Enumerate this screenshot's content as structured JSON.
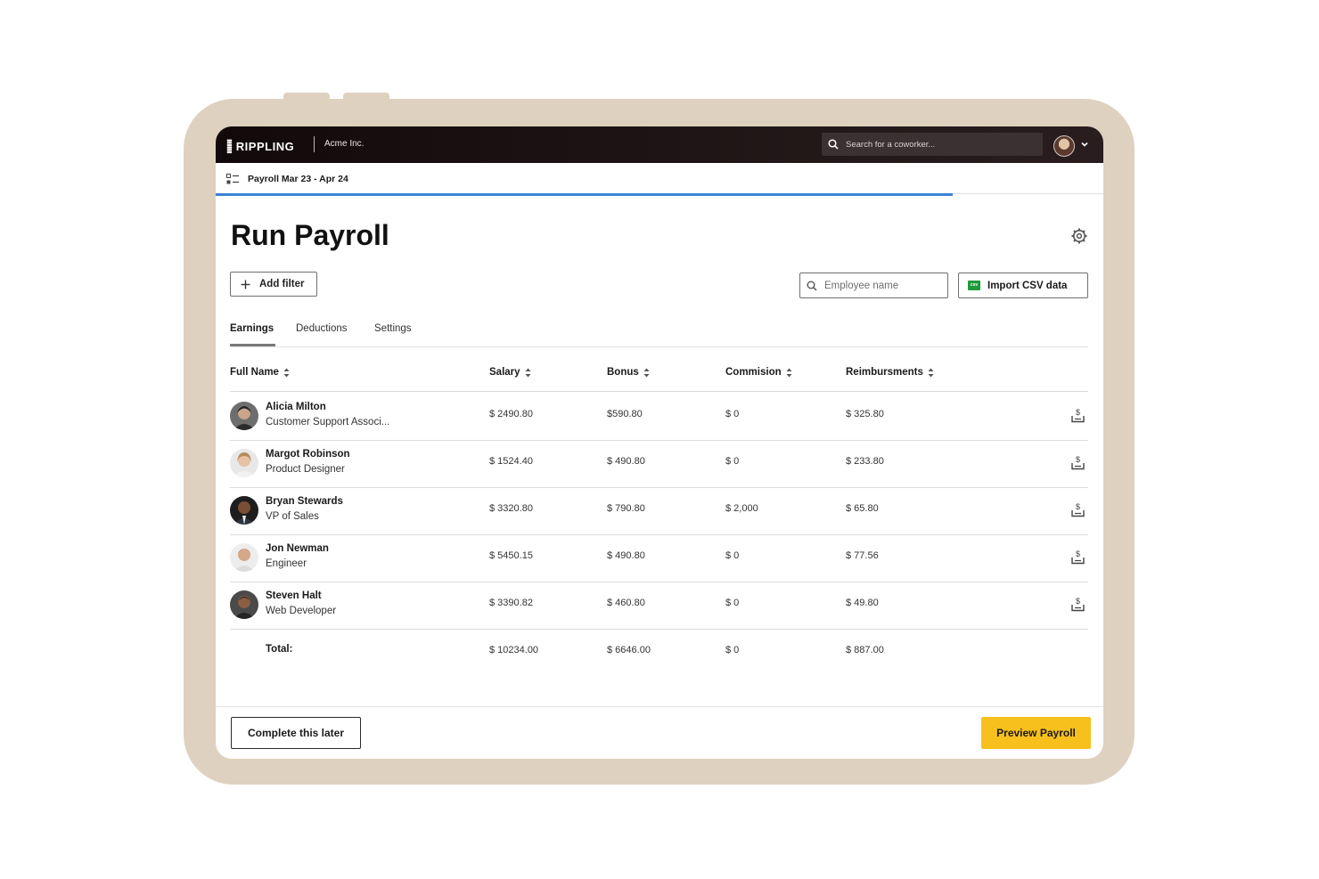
{
  "app": {
    "logo_text": "RIPPLING",
    "company": "Acme Inc.",
    "search_placeholder": "Search for a coworker...",
    "accent_color": "#3b82d6",
    "primary_button_color": "#f8c01c"
  },
  "subbar": {
    "title": "Payroll Mar 23 - Apr 24",
    "progress_fraction": 0.83
  },
  "header": {
    "title": "Run Payroll"
  },
  "toolbar": {
    "add_filter_label": "Add filter",
    "employee_search_placeholder": "Employee name",
    "import_label": "Import CSV data",
    "csv_badge": "csv"
  },
  "tabs": [
    {
      "label": "Earnings",
      "active": true
    },
    {
      "label": "Deductions",
      "active": false
    },
    {
      "label": "Settings",
      "active": false
    }
  ],
  "table": {
    "columns": [
      "Full Name",
      "Salary",
      "Bonus",
      "Commision",
      "Reimbursments"
    ],
    "rows": [
      {
        "name": "Alicia Milton",
        "role": "Customer Support Associ...",
        "salary": "$ 2490.80",
        "bonus": "$590.80",
        "commission": "$ 0",
        "reimbursements": "$ 325.80"
      },
      {
        "name": "Margot Robinson",
        "role": "Product Designer",
        "salary": "$ 1524.40",
        "bonus": "$ 490.80",
        "commission": "$ 0",
        "reimbursements": "$ 233.80"
      },
      {
        "name": "Bryan Stewards",
        "role": "VP of Sales",
        "salary": "$ 3320.80",
        "bonus": "$ 790.80",
        "commission": "$ 2,000",
        "reimbursements": "$ 65.80"
      },
      {
        "name": "Jon Newman",
        "role": "Engineer",
        "salary": "$ 5450.15",
        "bonus": "$ 490.80",
        "commission": "$ 0",
        "reimbursements": "$ 77.56"
      },
      {
        "name": "Steven Halt",
        "role": "Web Developer",
        "salary": "$ 3390.82",
        "bonus": "$ 460.80",
        "commission": "$ 0",
        "reimbursements": "$ 49.80"
      }
    ],
    "total": {
      "label": "Total:",
      "salary": "$ 10234.00",
      "bonus": "$ 6646.00",
      "commission": "$ 0",
      "reimbursements": "$ 887.00"
    }
  },
  "footer": {
    "secondary_label": "Complete this later",
    "primary_label": "Preview Payroll"
  }
}
